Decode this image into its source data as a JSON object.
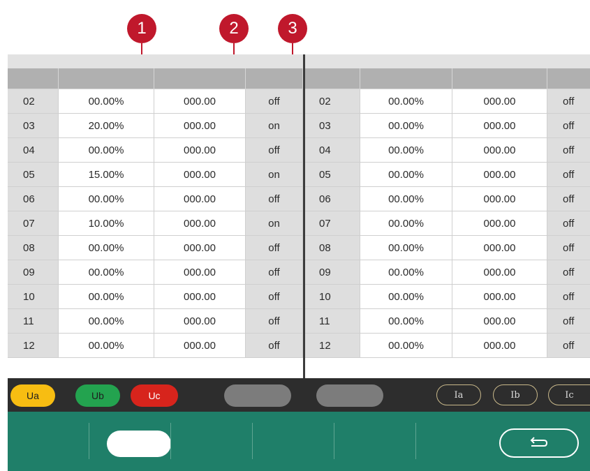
{
  "callouts": [
    "1",
    "2",
    "3"
  ],
  "table_left": {
    "rows": [
      {
        "num": "02",
        "pct": "00.00%",
        "val": "000.00",
        "status": "off"
      },
      {
        "num": "03",
        "pct": "20.00%",
        "val": "000.00",
        "status": "on"
      },
      {
        "num": "04",
        "pct": "00.00%",
        "val": "000.00",
        "status": "off"
      },
      {
        "num": "05",
        "pct": "15.00%",
        "val": "000.00",
        "status": "on"
      },
      {
        "num": "06",
        "pct": "00.00%",
        "val": "000.00",
        "status": "off"
      },
      {
        "num": "07",
        "pct": "10.00%",
        "val": "000.00",
        "status": "on"
      },
      {
        "num": "08",
        "pct": "00.00%",
        "val": "000.00",
        "status": "off"
      },
      {
        "num": "09",
        "pct": "00.00%",
        "val": "000.00",
        "status": "off"
      },
      {
        "num": "10",
        "pct": "00.00%",
        "val": "000.00",
        "status": "off"
      },
      {
        "num": "11",
        "pct": "00.00%",
        "val": "000.00",
        "status": "off"
      },
      {
        "num": "12",
        "pct": "00.00%",
        "val": "000.00",
        "status": "off"
      }
    ]
  },
  "table_right": {
    "rows": [
      {
        "num": "02",
        "pct": "00.00%",
        "val": "000.00",
        "status": "off"
      },
      {
        "num": "03",
        "pct": "00.00%",
        "val": "000.00",
        "status": "off"
      },
      {
        "num": "04",
        "pct": "00.00%",
        "val": "000.00",
        "status": "off"
      },
      {
        "num": "05",
        "pct": "00.00%",
        "val": "000.00",
        "status": "off"
      },
      {
        "num": "06",
        "pct": "00.00%",
        "val": "000.00",
        "status": "off"
      },
      {
        "num": "07",
        "pct": "00.00%",
        "val": "000.00",
        "status": "off"
      },
      {
        "num": "08",
        "pct": "00.00%",
        "val": "000.00",
        "status": "off"
      },
      {
        "num": "09",
        "pct": "00.00%",
        "val": "000.00",
        "status": "off"
      },
      {
        "num": "10",
        "pct": "00.00%",
        "val": "000.00",
        "status": "off"
      },
      {
        "num": "11",
        "pct": "00.00%",
        "val": "000.00",
        "status": "off"
      },
      {
        "num": "12",
        "pct": "00.00%",
        "val": "000.00",
        "status": "off"
      }
    ]
  },
  "status_bar": {
    "voltage_labels": [
      "Ua",
      "Ub",
      "Uc"
    ],
    "current_labels": [
      "Ia",
      "Ib",
      "Ic"
    ]
  },
  "bottom_bar": {
    "back_icon": "return-arrow-icon"
  },
  "colors": {
    "callout": "#c0182c",
    "ua": "#f7bd12",
    "ub": "#23a34f",
    "uc": "#d7241c",
    "bottom_bar": "#1f7f69",
    "status_bar": "#2d2d2d"
  }
}
